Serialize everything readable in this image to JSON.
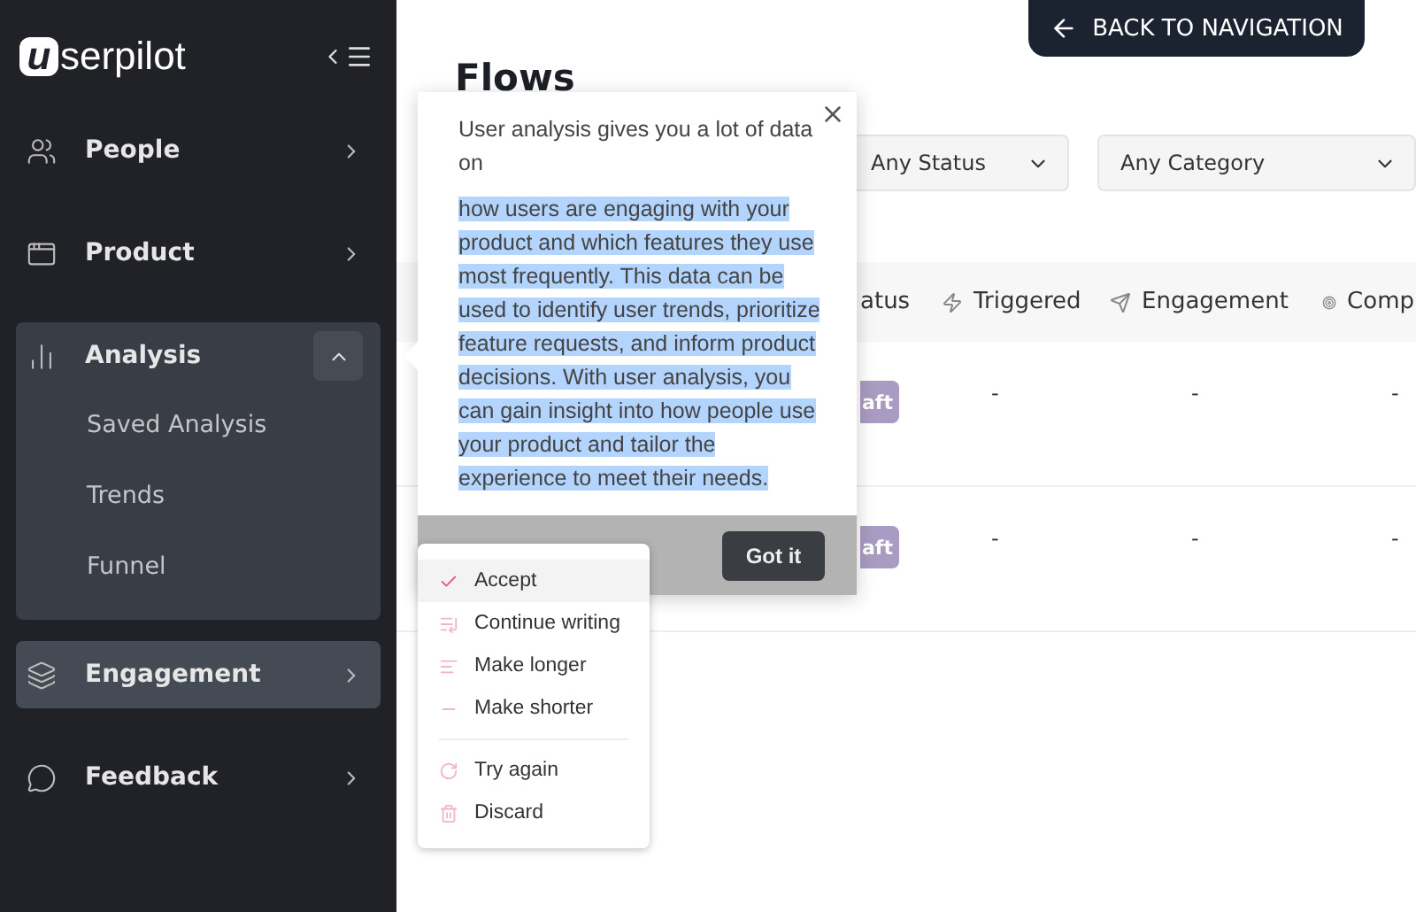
{
  "sidebar": {
    "logo": "userpilot",
    "items": [
      {
        "label": "People",
        "expanded": false,
        "selected": false
      },
      {
        "label": "Product",
        "expanded": false,
        "selected": false
      },
      {
        "label": "Analysis",
        "expanded": true,
        "selected": false,
        "children": [
          {
            "label": "Saved Analysis"
          },
          {
            "label": "Trends"
          },
          {
            "label": "Funnel"
          }
        ]
      },
      {
        "label": "Engagement",
        "expanded": false,
        "selected": true
      },
      {
        "label": "Feedback",
        "expanded": false,
        "selected": false
      }
    ]
  },
  "back_button": "BACK TO NAVIGATION",
  "page_title": "Flows",
  "filters": [
    {
      "value": "Any Status"
    },
    {
      "value": "Any Category"
    }
  ],
  "table": {
    "columns": [
      {
        "label": "atus"
      },
      {
        "label": "Triggered"
      },
      {
        "label": "Engagement"
      },
      {
        "label": "Comp"
      }
    ],
    "rows": [
      {
        "cells": [
          "aft",
          "-",
          "-",
          "-"
        ]
      },
      {
        "cells": [
          "aft",
          "-",
          "-",
          "-"
        ]
      }
    ]
  },
  "popover": {
    "paragraphs": [
      {
        "text": "User analysis gives you a lot of data on",
        "highlighted": false
      },
      {
        "text": "how users are engaging with your product and which features they use most frequently. This data can be used to identify user trends, prioritize feature requests, and inform product decisions. With user analysis, you can gain insight into how people use your product and tailor the experience to meet their needs.",
        "highlighted": true
      }
    ],
    "button": "Got it"
  },
  "ai_menu": {
    "groups": [
      [
        {
          "label": "Accept",
          "selected": true
        },
        {
          "label": "Continue writing",
          "selected": false
        },
        {
          "label": "Make longer",
          "selected": false
        },
        {
          "label": "Make shorter",
          "selected": false
        }
      ],
      [
        {
          "label": "Try again",
          "selected": false
        },
        {
          "label": "Discard",
          "selected": false
        }
      ]
    ]
  }
}
